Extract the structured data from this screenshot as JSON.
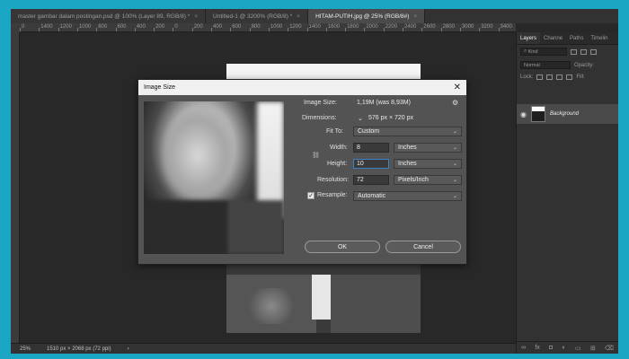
{
  "tabs": [
    {
      "label": "master gambar dalam postingan.psd @ 100% (Layer 89, RGB/8) *",
      "close": "×"
    },
    {
      "label": "Untitled-1 @ 3200% (RGB/8) *",
      "close": "×"
    },
    {
      "label": "HITAM-PUTIH.jpg @ 25% (RGB/8#)",
      "close": "×"
    }
  ],
  "ruler": [
    "0",
    "1400",
    "1200",
    "1000",
    "800",
    "600",
    "400",
    "200",
    "0",
    "200",
    "400",
    "600",
    "800",
    "1000",
    "1200",
    "1400",
    "1600",
    "1800",
    "2000",
    "2200",
    "2400",
    "2600",
    "2800",
    "3000",
    "3200",
    "3400"
  ],
  "status": {
    "zoom": "25%",
    "doc_size": "1510 px × 2068 px (72 ppi)",
    "arrow": "›"
  },
  "panel": {
    "tabs": [
      "Layers",
      "Channe",
      "Paths",
      "Timelin"
    ],
    "kind_label": "Kind",
    "blend": "Normal",
    "opacity_label": "Opacity:",
    "lock_label": "Lock:",
    "fill_label": "Fill:",
    "layer_name": "Background",
    "footer_icons": [
      "link-icon",
      "fx-icon",
      "mask-icon",
      "adjust-icon",
      "folder-icon",
      "new-layer-icon",
      "trash-icon"
    ]
  },
  "dialog": {
    "title": "Image Size",
    "close": "✕",
    "image_size_label": "Image Size:",
    "image_size_value": "1,19M (was 8,93M)",
    "dimensions_label": "Dimensions:",
    "dimensions_value": "576 px  ×  720 px",
    "fit_to_label": "Fit To:",
    "fit_to_value": "Custom",
    "width_label": "Width:",
    "width_value": "8",
    "width_unit": "Inches",
    "height_label": "Height:",
    "height_value": "10",
    "height_unit": "Inches",
    "resolution_label": "Resolution:",
    "resolution_value": "72",
    "resolution_unit": "Pixels/Inch",
    "resample_label": "Resample:",
    "resample_value": "Automatic",
    "ok_label": "OK",
    "cancel_label": "Cancel"
  }
}
